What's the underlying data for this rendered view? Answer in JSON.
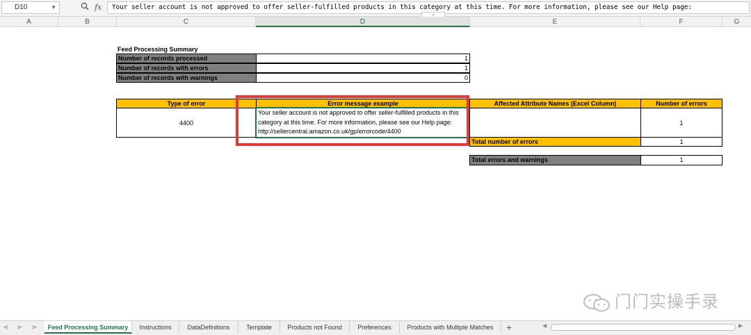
{
  "formula_bar": {
    "name_box": "D10",
    "fx_label": "fx",
    "formula": "Your seller account is not approved to offer seller-fulfilled products in this category at this time. For more information, please see our Help page:"
  },
  "columns": [
    "A",
    "B",
    "C",
    "D",
    "E",
    "F",
    "G"
  ],
  "summary": {
    "title": "Feed Processing Summary",
    "rows": [
      {
        "label": "Number of records processed",
        "value": "1"
      },
      {
        "label": "Number of records with errors",
        "value": "1"
      },
      {
        "label": "Number of records with warnings",
        "value": "0"
      }
    ]
  },
  "errors_table": {
    "headers": [
      "Type of error",
      "Error message example",
      "Affected Attribute Names (Excel Column)",
      "Number of errors"
    ],
    "row": {
      "type": "4400",
      "message": "Your seller account is not approved to offer seller-fulfilled products in this category at this time. For more information, please see our Help page: http://sellercentral.amazon.co.uk/gp/errorcode/4400",
      "attributes": "",
      "count": "1"
    },
    "total_errors": {
      "label": "Total number of errors",
      "value": "1"
    },
    "total_errors_warnings": {
      "label": "Total errors and warnings",
      "value": "1"
    }
  },
  "sheet_tabs": [
    "Feed Processing Summary",
    "Instructions",
    "DataDefinitions",
    "Template",
    "Products not Found",
    "Preferences",
    "Products with Multiple Matches"
  ],
  "active_tab": "Feed Processing Summary",
  "watermark": "门门实操手录",
  "colors": {
    "accent": "#217346",
    "header_yellow": "#ffc000",
    "label_gray": "#808080",
    "highlight_red": "#e53935"
  }
}
